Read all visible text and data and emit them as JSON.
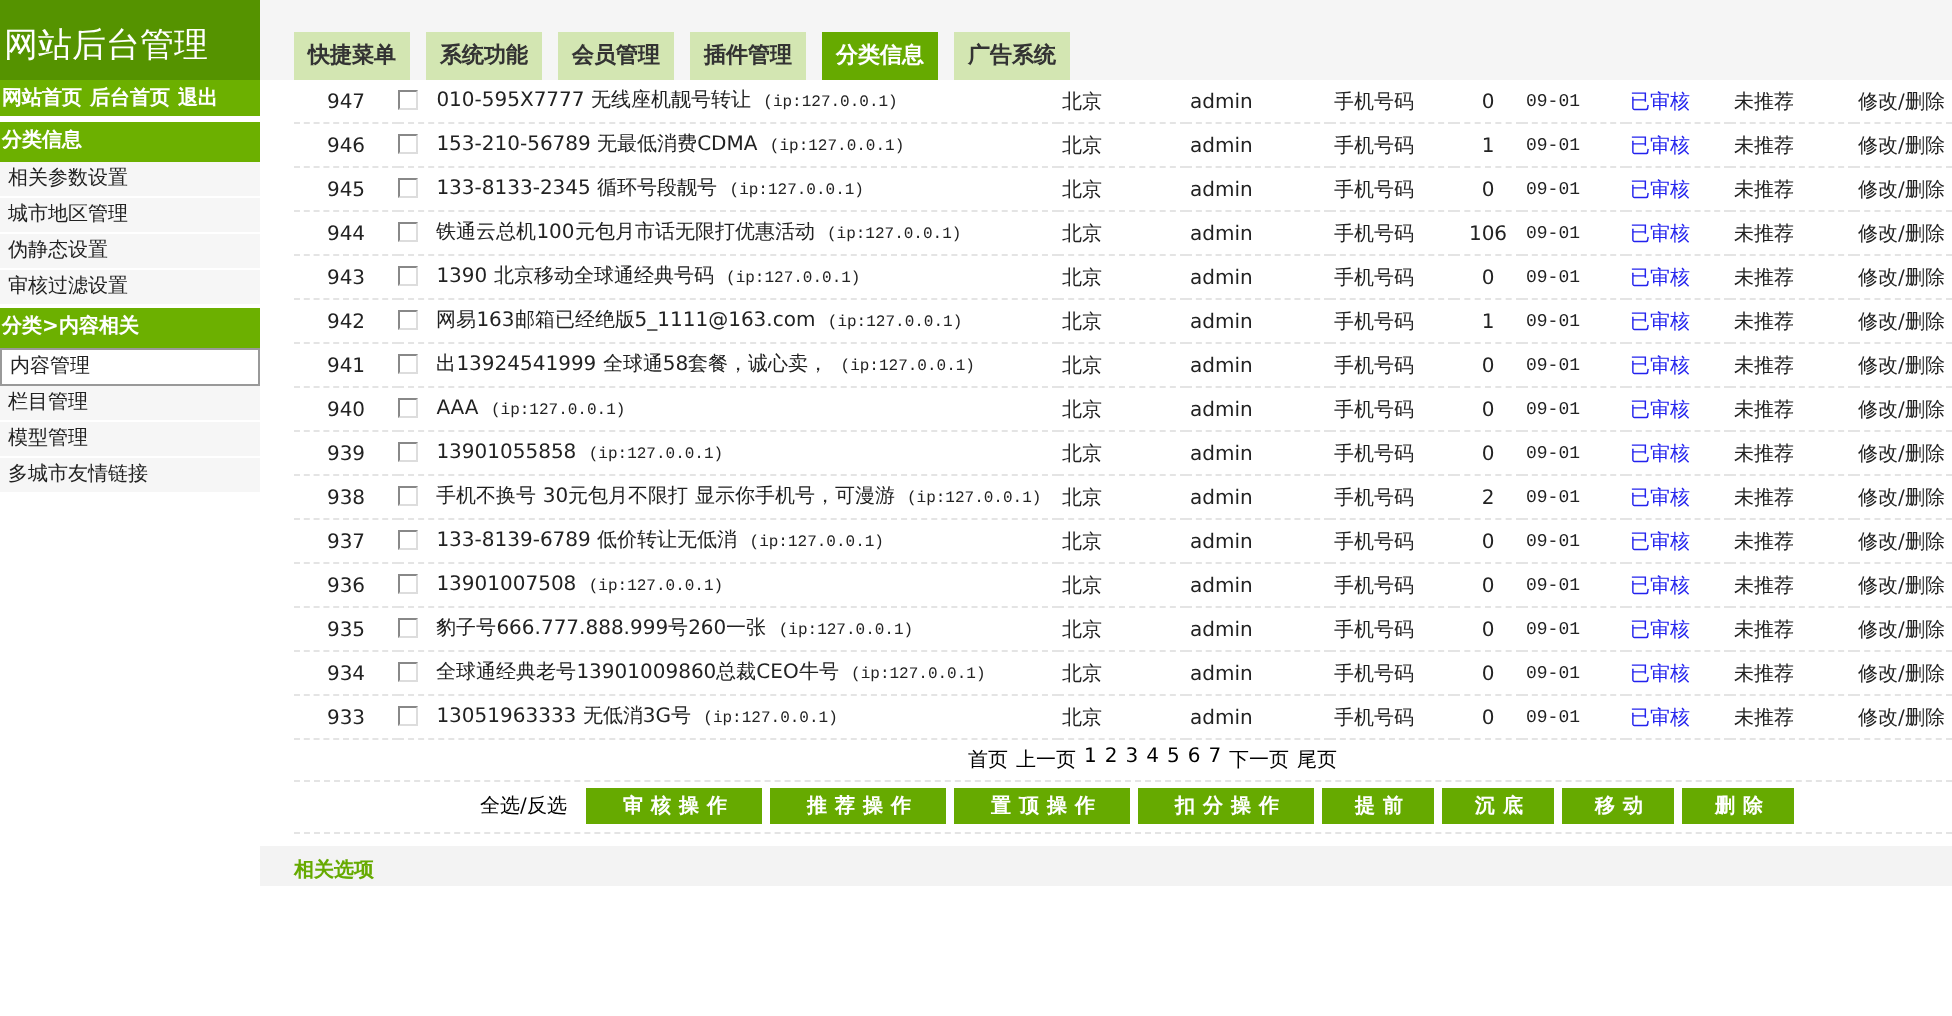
{
  "sidebar": {
    "title": "网站后台管理",
    "links": [
      "网站首页",
      "后台首页",
      "退出"
    ],
    "sections": [
      {
        "title": "分类信息",
        "items": [
          {
            "label": "相关参数设置",
            "selected": false
          },
          {
            "label": "城市地区管理",
            "selected": false
          },
          {
            "label": "伪静态设置",
            "selected": false
          },
          {
            "label": "审核过滤设置",
            "selected": false
          }
        ]
      },
      {
        "title": "分类>内容相关",
        "items": [
          {
            "label": "内容管理",
            "selected": true
          },
          {
            "label": "栏目管理",
            "selected": false
          },
          {
            "label": "模型管理",
            "selected": false
          },
          {
            "label": "多城市友情链接",
            "selected": false
          }
        ]
      }
    ]
  },
  "tabs": [
    {
      "label": "快捷菜单",
      "selected": false
    },
    {
      "label": "系统功能",
      "selected": false
    },
    {
      "label": "会员管理",
      "selected": false
    },
    {
      "label": "插件管理",
      "selected": false
    },
    {
      "label": "分类信息",
      "selected": true
    },
    {
      "label": "广告系统",
      "selected": false
    }
  ],
  "table": {
    "rows": [
      {
        "id": "947",
        "checked": false,
        "title": "010-595X7777 无线座机靓号转让",
        "ip": "(ip:127.0.0.1)",
        "city": "北京",
        "user": "admin",
        "category": "手机号码",
        "count": "0",
        "date": "09-01",
        "status": "已审核",
        "recommend": "未推荐",
        "actions": "修改/删除"
      },
      {
        "id": "946",
        "checked": false,
        "title": "153-210-56789 无最低消费CDMA",
        "ip": "(ip:127.0.0.1)",
        "city": "北京",
        "user": "admin",
        "category": "手机号码",
        "count": "1",
        "date": "09-01",
        "status": "已审核",
        "recommend": "未推荐",
        "actions": "修改/删除"
      },
      {
        "id": "945",
        "checked": false,
        "title": "133-8133-2345 循环号段靓号",
        "ip": "(ip:127.0.0.1)",
        "city": "北京",
        "user": "admin",
        "category": "手机号码",
        "count": "0",
        "date": "09-01",
        "status": "已审核",
        "recommend": "未推荐",
        "actions": "修改/删除"
      },
      {
        "id": "944",
        "checked": false,
        "title": "铁通云总机100元包月市话无限打优惠活动",
        "ip": "(ip:127.0.0.1)",
        "city": "北京",
        "user": "admin",
        "category": "手机号码",
        "count": "106",
        "date": "09-01",
        "status": "已审核",
        "recommend": "未推荐",
        "actions": "修改/删除"
      },
      {
        "id": "943",
        "checked": false,
        "title": "1390 北京移动全球通经典号码",
        "ip": "(ip:127.0.0.1)",
        "city": "北京",
        "user": "admin",
        "category": "手机号码",
        "count": "0",
        "date": "09-01",
        "status": "已审核",
        "recommend": "未推荐",
        "actions": "修改/删除"
      },
      {
        "id": "942",
        "checked": false,
        "title": "网易163邮箱已经绝版5_1111@163.com",
        "ip": "(ip:127.0.0.1)",
        "city": "北京",
        "user": "admin",
        "category": "手机号码",
        "count": "1",
        "date": "09-01",
        "status": "已审核",
        "recommend": "未推荐",
        "actions": "修改/删除"
      },
      {
        "id": "941",
        "checked": false,
        "title": "出13924541999 全球通58套餐，诚心卖，",
        "ip": "(ip:127.0.0.1)",
        "city": "北京",
        "user": "admin",
        "category": "手机号码",
        "count": "0",
        "date": "09-01",
        "status": "已审核",
        "recommend": "未推荐",
        "actions": "修改/删除"
      },
      {
        "id": "940",
        "checked": false,
        "title": "AAA",
        "ip": "(ip:127.0.0.1)",
        "city": "北京",
        "user": "admin",
        "category": "手机号码",
        "count": "0",
        "date": "09-01",
        "status": "已审核",
        "recommend": "未推荐",
        "actions": "修改/删除"
      },
      {
        "id": "939",
        "checked": false,
        "title": "13901055858",
        "ip": "(ip:127.0.0.1)",
        "city": "北京",
        "user": "admin",
        "category": "手机号码",
        "count": "0",
        "date": "09-01",
        "status": "已审核",
        "recommend": "未推荐",
        "actions": "修改/删除"
      },
      {
        "id": "938",
        "checked": false,
        "title": "手机不换号 30元包月不限打 显示你手机号，可漫游",
        "ip": "(ip:127.0.0.1)",
        "city": "北京",
        "user": "admin",
        "category": "手机号码",
        "count": "2",
        "date": "09-01",
        "status": "已审核",
        "recommend": "未推荐",
        "actions": "修改/删除"
      },
      {
        "id": "937",
        "checked": false,
        "title": "133-8139-6789 低价转让无低消",
        "ip": "(ip:127.0.0.1)",
        "city": "北京",
        "user": "admin",
        "category": "手机号码",
        "count": "0",
        "date": "09-01",
        "status": "已审核",
        "recommend": "未推荐",
        "actions": "修改/删除"
      },
      {
        "id": "936",
        "checked": false,
        "title": "13901007508",
        "ip": "(ip:127.0.0.1)",
        "city": "北京",
        "user": "admin",
        "category": "手机号码",
        "count": "0",
        "date": "09-01",
        "status": "已审核",
        "recommend": "未推荐",
        "actions": "修改/删除"
      },
      {
        "id": "935",
        "checked": false,
        "title": "豹子号666.777.888.999号260一张",
        "ip": "(ip:127.0.0.1)",
        "city": "北京",
        "user": "admin",
        "category": "手机号码",
        "count": "0",
        "date": "09-01",
        "status": "已审核",
        "recommend": "未推荐",
        "actions": "修改/删除"
      },
      {
        "id": "934",
        "checked": false,
        "title": "全球通经典老号13901009860总裁CEO牛号",
        "ip": "(ip:127.0.0.1)",
        "city": "北京",
        "user": "admin",
        "category": "手机号码",
        "count": "0",
        "date": "09-01",
        "status": "已审核",
        "recommend": "未推荐",
        "actions": "修改/删除"
      },
      {
        "id": "933",
        "checked": false,
        "title": "13051963333 无低消3G号",
        "ip": "(ip:127.0.0.1)",
        "city": "北京",
        "user": "admin",
        "category": "手机号码",
        "count": "0",
        "date": "09-01",
        "status": "已审核",
        "recommend": "未推荐",
        "actions": "修改/删除"
      }
    ]
  },
  "pagination": [
    "首页",
    "上一页",
    "1",
    "2",
    "3",
    "4",
    "5",
    "6",
    "7",
    "下一页",
    "尾页"
  ],
  "select_toggle": "全选/反选",
  "actions": [
    "审核操作",
    "推荐操作",
    "置顶操作",
    "扣分操作",
    "提前",
    "沉底",
    "移动",
    "删除"
  ],
  "footer_section": "相关选项"
}
